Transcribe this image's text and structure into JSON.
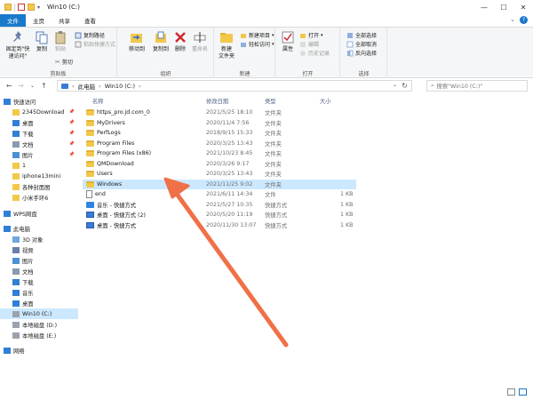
{
  "window": {
    "title": "Win10 (C:)"
  },
  "tabs": [
    "文件",
    "主页",
    "共享",
    "查看"
  ],
  "ribbon": {
    "clipboard": {
      "label": "剪贴板",
      "pin_quick": "固定到\"快\n速访问\"",
      "copy": "复制",
      "paste": "粘贴",
      "cut": "剪切",
      "copy_path": "复制路径",
      "paste_shortcut": "粘贴快捷方式"
    },
    "organize": {
      "label": "组织",
      "move_to": "移动到",
      "copy_to": "复制到",
      "delete": "删除",
      "rename": "重命名"
    },
    "new": {
      "label": "新建",
      "new_folder": "新建\n文件夹",
      "new_item": "新建项目",
      "easy_access": "轻松访问"
    },
    "open": {
      "label": "打开",
      "properties": "属性",
      "open": "打开",
      "edit": "编辑",
      "history": "历史记录"
    },
    "select": {
      "label": "选择",
      "select_all": "全部选择",
      "select_none": "全部取消",
      "invert": "反向选择"
    }
  },
  "nav": {
    "breadcrumb": [
      "此电脑",
      "Win10 (C:)"
    ],
    "search_placeholder": "搜索\"Win10 (C:)\""
  },
  "sidebar": [
    {
      "label": "快速访问",
      "icon": "star-icon",
      "pinned": false
    },
    {
      "label": "2345Download",
      "icon": "folder-icon",
      "pinned": true
    },
    {
      "label": "桌面",
      "icon": "desktop-icon",
      "pinned": true
    },
    {
      "label": "下载",
      "icon": "download-icon",
      "pinned": true
    },
    {
      "label": "文档",
      "icon": "document-icon",
      "pinned": true
    },
    {
      "label": "图片",
      "icon": "picture-icon",
      "pinned": true
    },
    {
      "label": "1",
      "icon": "folder-icon",
      "pinned": false
    },
    {
      "label": "iphone13mini",
      "icon": "folder-icon",
      "pinned": false
    },
    {
      "label": "各种封面图",
      "icon": "folder-icon",
      "pinned": false
    },
    {
      "label": "小米手环6",
      "icon": "folder-icon",
      "pinned": false
    },
    {
      "label": "WPS网盘",
      "icon": "cloud-icon",
      "pinned": false
    },
    {
      "label": "此电脑",
      "icon": "computer-icon",
      "pinned": false
    },
    {
      "label": "3D 对象",
      "icon": "cube-icon",
      "pinned": false
    },
    {
      "label": "视频",
      "icon": "video-icon",
      "pinned": false
    },
    {
      "label": "图片",
      "icon": "picture-icon",
      "pinned": false
    },
    {
      "label": "文档",
      "icon": "document-icon",
      "pinned": false
    },
    {
      "label": "下载",
      "icon": "download-icon",
      "pinned": false
    },
    {
      "label": "音乐",
      "icon": "music-icon",
      "pinned": false
    },
    {
      "label": "桌面",
      "icon": "desktop-icon",
      "pinned": false
    },
    {
      "label": "Win10 (C:)",
      "icon": "drive-icon",
      "pinned": false
    },
    {
      "label": "本地磁盘 (D:)",
      "icon": "drive-icon",
      "pinned": false
    },
    {
      "label": "本地磁盘 (E:)",
      "icon": "drive-icon",
      "pinned": false
    },
    {
      "label": "网络",
      "icon": "network-icon",
      "pinned": false
    }
  ],
  "columns": {
    "name": "名称",
    "date": "修改日期",
    "type": "类型",
    "size": "大小"
  },
  "files": [
    {
      "name": "https_pro.jd.com_0",
      "date": "2021/5/25 18:10",
      "type": "文件夹",
      "size": "",
      "icon": "folder"
    },
    {
      "name": "MyDrivers",
      "date": "2020/11/4 7:56",
      "type": "文件夹",
      "size": "",
      "icon": "folder"
    },
    {
      "name": "PerfLogs",
      "date": "2018/9/15 15:33",
      "type": "文件夹",
      "size": "",
      "icon": "folder"
    },
    {
      "name": "Program Files",
      "date": "2020/3/25 13:43",
      "type": "文件夹",
      "size": "",
      "icon": "folder"
    },
    {
      "name": "Program Files (x86)",
      "date": "2021/10/23 8:45",
      "type": "文件夹",
      "size": "",
      "icon": "folder"
    },
    {
      "name": "QMDownload",
      "date": "2020/3/26 9:17",
      "type": "文件夹",
      "size": "",
      "icon": "folder"
    },
    {
      "name": "Users",
      "date": "2020/3/25 13:43",
      "type": "文件夹",
      "size": "",
      "icon": "folder"
    },
    {
      "name": "Windows",
      "date": "2021/11/25 9:02",
      "type": "文件夹",
      "size": "",
      "icon": "folder"
    },
    {
      "name": "end",
      "date": "2021/6/11 14:34",
      "type": "文件",
      "size": "1 KB",
      "icon": "file"
    },
    {
      "name": "音乐 - 快捷方式",
      "date": "2021/5/27 10:35",
      "type": "快捷方式",
      "size": "1 KB",
      "icon": "music"
    },
    {
      "name": "桌面 - 快捷方式 (2)",
      "date": "2020/5/20 11:19",
      "type": "快捷方式",
      "size": "1 KB",
      "icon": "shortcut"
    },
    {
      "name": "桌面 - 快捷方式",
      "date": "2020/11/30 13:07",
      "type": "快捷方式",
      "size": "1 KB",
      "icon": "shortcut"
    }
  ],
  "selected_file_index": 7,
  "colors": {
    "accent": "#1979ca",
    "selection": "#cce8ff",
    "arrow": "#f07048",
    "folder": "#f2c84b"
  }
}
